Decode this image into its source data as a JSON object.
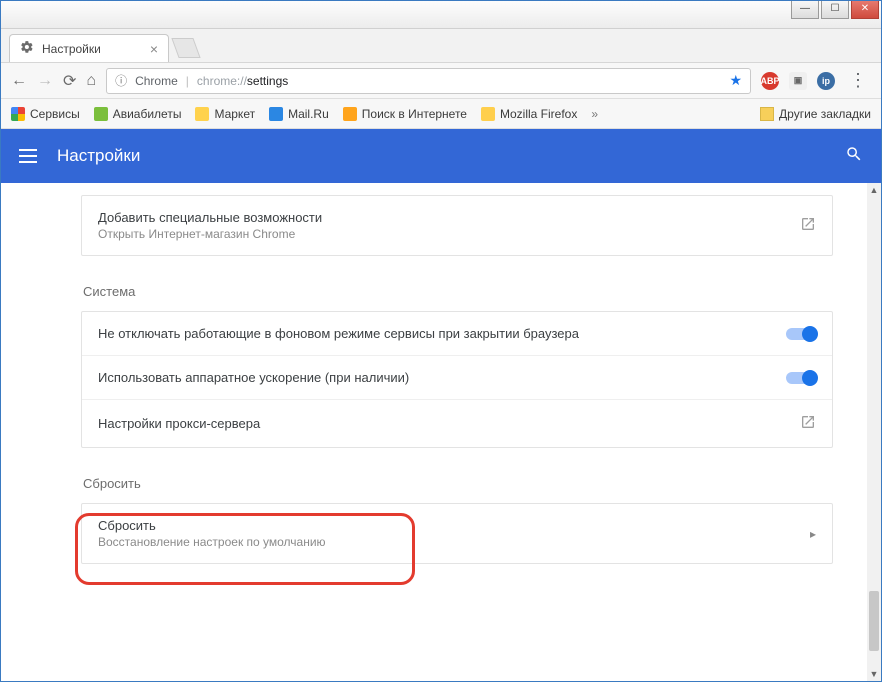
{
  "window": {
    "minimize": "—",
    "maximize": "☐",
    "close": "✕"
  },
  "tab": {
    "title": "Настройки",
    "close": "×"
  },
  "toolbar": {
    "back": "←",
    "forward": "→",
    "reload": "⟳",
    "home": "⌂",
    "secure_label": "Chrome",
    "url_protocol": "chrome://",
    "url_path": "settings",
    "star": "★",
    "menu": "⋮",
    "ext_abp": "ABP",
    "ext_ip": "ip"
  },
  "bookmarks": {
    "apps": "Сервисы",
    "avia": "Авиабилеты",
    "market": "Маркет",
    "mail": "Mail.Ru",
    "search": "Поиск в Интернете",
    "mozilla": "Mozilla Firefox",
    "expand": "»",
    "other": "Другие закладки"
  },
  "settings": {
    "header_title": "Настройки"
  },
  "accessibility": {
    "title": "Добавить специальные возможности",
    "subtitle": "Открыть Интернет-магазин Chrome"
  },
  "system": {
    "heading": "Система",
    "row_bg": "Не отключать работающие в фоновом режиме сервисы при закрытии браузера",
    "row_hw": "Использовать аппаратное ускорение (при наличии)",
    "row_proxy": "Настройки прокси-сервера"
  },
  "reset": {
    "heading": "Сбросить",
    "title": "Сбросить",
    "subtitle": "Восстановление настроек по умолчанию",
    "arrow": "▸"
  },
  "scroll": {
    "up": "▲",
    "down": "▼"
  }
}
